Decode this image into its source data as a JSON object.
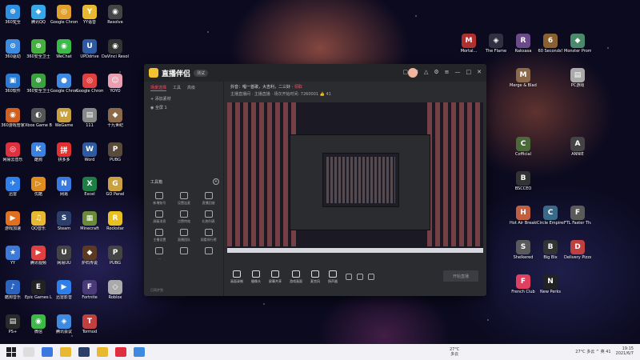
{
  "desktop": {
    "left_cols": [
      [
        {
          "label": "360安全",
          "color": "#2f8fe0",
          "ch": "⊕"
        },
        {
          "label": "360驱动",
          "color": "#3c8be0",
          "ch": "⊙"
        },
        {
          "label": "360软件",
          "color": "#2b7ad0",
          "ch": "▣"
        },
        {
          "label": "360游戏管家",
          "color": "#d06020",
          "ch": "◉"
        },
        {
          "label": "网易云音乐",
          "color": "#e03040",
          "ch": "◎"
        },
        {
          "label": "迅雷",
          "color": "#2f7fe8",
          "ch": "✈"
        },
        {
          "label": "游戏加速",
          "color": "#e07020",
          "ch": "▶"
        },
        {
          "label": "YY",
          "color": "#3d7ad8",
          "ch": "★"
        },
        {
          "label": "酷狗音乐",
          "color": "#2a63c0",
          "ch": "♪"
        },
        {
          "label": "PS+",
          "color": "#2a2a2a",
          "ch": "▤"
        }
      ],
      [
        {
          "label": "腾讯QQ",
          "color": "#37a7e8",
          "ch": "◆"
        },
        {
          "label": "360安全卫士",
          "color": "#45b040",
          "ch": "⊕"
        },
        {
          "label": "360安全卫士",
          "color": "#3aa040",
          "ch": "⊕"
        },
        {
          "label": "Xbox Game Bar",
          "color": "#555",
          "ch": "◐"
        },
        {
          "label": "酷狗",
          "color": "#3b82e0",
          "ch": "K"
        },
        {
          "label": "优酷",
          "color": "#e08d20",
          "ch": "▷"
        },
        {
          "label": "QQ音乐",
          "color": "#e8b830",
          "ch": "♫"
        },
        {
          "label": "腾讯视频",
          "color": "#e04040",
          "ch": "▶"
        },
        {
          "label": "Epic Games Launcher",
          "color": "#222",
          "ch": "E"
        },
        {
          "label": "微信",
          "color": "#3cba48",
          "ch": "◉"
        }
      ],
      [
        {
          "label": "Google Chrome",
          "color": "#e0a030",
          "ch": "◎"
        },
        {
          "label": "WeChat",
          "color": "#3cba48",
          "ch": "◉"
        },
        {
          "label": "Google Chrome",
          "color": "#3d8ae0",
          "ch": "●"
        },
        {
          "label": "WeGame",
          "color": "#c8a040",
          "ch": "W"
        },
        {
          "label": "拼多多",
          "color": "#e03030",
          "ch": "拼"
        },
        {
          "label": "网易",
          "color": "#3a7ae0",
          "ch": "N"
        },
        {
          "label": "Steam",
          "color": "#2a3f6a",
          "ch": "S"
        },
        {
          "label": "网易UU",
          "color": "#444",
          "ch": "U"
        },
        {
          "label": "迅雷影音",
          "color": "#2f7fe8",
          "ch": "▶"
        },
        {
          "label": "腾讯会议",
          "color": "#3d8ae0",
          "ch": "◈"
        }
      ],
      [
        {
          "label": "YY语音",
          "color": "#e8b830",
          "ch": "Y"
        },
        {
          "label": "UPDdrive",
          "color": "#2d5aa0",
          "ch": "U"
        },
        {
          "label": "Google Chrome",
          "color": "#e04040",
          "ch": "◎"
        },
        {
          "label": "111",
          "color": "#888",
          "ch": "▤"
        },
        {
          "label": "Word",
          "color": "#2d5aa0",
          "ch": "W"
        },
        {
          "label": "Excel",
          "color": "#1e7d45",
          "ch": "X"
        },
        {
          "label": "Minecraft",
          "color": "#6a8a3a",
          "ch": "▦"
        },
        {
          "label": "炉石传说",
          "color": "#5a3a20",
          "ch": "◆"
        },
        {
          "label": "Fortnite",
          "color": "#4a3a7a",
          "ch": "F"
        },
        {
          "label": "Tormod",
          "color": "#c04040",
          "ch": "T"
        }
      ],
      [
        {
          "label": "Resolve",
          "color": "#444",
          "ch": "◉"
        },
        {
          "label": "DaVinci Resolve",
          "color": "#333",
          "ch": "◉"
        },
        {
          "label": "YOYO",
          "color": "#e8a0b0",
          "ch": "☺"
        },
        {
          "label": "十九世纪",
          "color": "#8a6a4a",
          "ch": "◆"
        },
        {
          "label": "PUBG",
          "color": "#5a4a3a",
          "ch": "P"
        },
        {
          "label": "GO Panel",
          "color": "#caa040",
          "ch": "G"
        },
        {
          "label": "Rockstar",
          "color": "#e8c020",
          "ch": "R"
        },
        {
          "label": "PUBG",
          "color": "#444",
          "ch": "P"
        },
        {
          "label": "Roblox",
          "color": "#aaa",
          "ch": "◇"
        },
        {
          "label": "",
          "color": "transparent",
          "ch": ""
        }
      ]
    ],
    "right_cols": [
      [
        {
          "label": "Mortal...",
          "color": "#b03030",
          "ch": "M"
        },
        {
          "label": "",
          "color": "transparent",
          "ch": ""
        },
        {
          "label": "",
          "color": "transparent",
          "ch": ""
        },
        {
          "label": "",
          "color": "transparent",
          "ch": ""
        },
        {
          "label": "",
          "color": "transparent",
          "ch": ""
        },
        {
          "label": "",
          "color": "transparent",
          "ch": ""
        },
        {
          "label": "",
          "color": "transparent",
          "ch": ""
        },
        {
          "label": "",
          "color": "transparent",
          "ch": ""
        },
        {
          "label": "",
          "color": "transparent",
          "ch": ""
        }
      ],
      [
        {
          "label": "The Flame",
          "color": "#303040",
          "ch": "◈"
        },
        {
          "label": "",
          "color": "transparent",
          "ch": ""
        },
        {
          "label": "",
          "color": "transparent",
          "ch": ""
        },
        {
          "label": "",
          "color": "transparent",
          "ch": ""
        },
        {
          "label": "",
          "color": "transparent",
          "ch": ""
        },
        {
          "label": "",
          "color": "transparent",
          "ch": ""
        },
        {
          "label": "",
          "color": "transparent",
          "ch": ""
        },
        {
          "label": "",
          "color": "transparent",
          "ch": ""
        },
        {
          "label": "",
          "color": "transparent",
          "ch": ""
        }
      ],
      [
        {
          "label": "Raksasa",
          "color": "#6a4a8a",
          "ch": "R"
        },
        {
          "label": "Merge & Blade",
          "color": "#8a6a4a",
          "ch": "M"
        },
        {
          "label": "",
          "color": "transparent",
          "ch": ""
        },
        {
          "label": "Cofficial",
          "color": "#4a6a3a",
          "ch": "C"
        },
        {
          "label": "BSCCEO",
          "color": "#333",
          "ch": "B"
        },
        {
          "label": "Hot Air Breakfast",
          "color": "#c06040",
          "ch": "H"
        },
        {
          "label": "Shelkered",
          "color": "#5a5a5a",
          "ch": "S"
        },
        {
          "label": "French Club",
          "color": "#e04060",
          "ch": "F"
        },
        {
          "label": "",
          "color": "transparent",
          "ch": ""
        }
      ],
      [
        {
          "label": "60 Seconds!",
          "color": "#8a6030",
          "ch": "6"
        },
        {
          "label": "",
          "color": "transparent",
          "ch": ""
        },
        {
          "label": "",
          "color": "transparent",
          "ch": ""
        },
        {
          "label": "",
          "color": "transparent",
          "ch": ""
        },
        {
          "label": "",
          "color": "transparent",
          "ch": ""
        },
        {
          "label": "Circle Empires",
          "color": "#3a6a8a",
          "ch": "C"
        },
        {
          "label": "Big Bix",
          "color": "#333",
          "ch": "B"
        },
        {
          "label": "New Perks",
          "color": "#222",
          "ch": "N"
        },
        {
          "label": "",
          "color": "transparent",
          "ch": ""
        }
      ],
      [
        {
          "label": "Monster Prom",
          "color": "#4a8a6a",
          "ch": "◆"
        },
        {
          "label": "PC游戏",
          "color": "#aaa",
          "ch": "▤"
        },
        {
          "label": "",
          "color": "transparent",
          "ch": ""
        },
        {
          "label": "ANNIE",
          "color": "#444",
          "ch": "A"
        },
        {
          "label": "",
          "color": "transparent",
          "ch": ""
        },
        {
          "label": "FTL Faster Than Light",
          "color": "#5a5a5a",
          "ch": "F"
        },
        {
          "label": "Delivery Pizza",
          "color": "#c04040",
          "ch": "D"
        },
        {
          "label": "",
          "color": "transparent",
          "ch": ""
        },
        {
          "label": "",
          "color": "transparent",
          "ch": ""
        }
      ]
    ]
  },
  "app": {
    "name": "直播伴侣",
    "version": "测试",
    "tabs": [
      "场景选择",
      "工具",
      "高级"
    ],
    "active_tab": "场景选择",
    "scene_items": [
      "+ 添加素材",
      "◉  全屏 1"
    ],
    "info_line1": "抖音：唱一首歌，大吉利，二三好 · ",
    "info_red": "领取",
    "info_line2": "主播直播间 · 主播直播  ·  场次开始时间: 7260001   👍 41",
    "tools_title": "工具箱",
    "tools": [
      {
        "label": "新增账号"
      },
      {
        "label": "设置连麦"
      },
      {
        "label": "直播回放"
      },
      {
        "label": "屏蔽消息"
      },
      {
        "label": "点赞特效"
      },
      {
        "label": "礼物列表"
      },
      {
        "label": "主播设置"
      },
      {
        "label": "直播团队"
      },
      {
        "label": "观看排行榜"
      },
      {
        "label": "...",
        "row4": true
      },
      {
        "label": "",
        "row4": true
      },
      {
        "label": "",
        "row4": true
      }
    ],
    "left_footer": "已同步到 "
  },
  "controls": [
    {
      "label": "画面录制"
    },
    {
      "label": "摄像头"
    },
    {
      "label": "屏幕共享"
    },
    {
      "label": "游戏画面"
    },
    {
      "label": "麦克风"
    },
    {
      "label": "扬声器"
    }
  ],
  "controls_live": "开始直播",
  "taskbar": {
    "weather_temp": "27°C",
    "weather_desc": "多云",
    "tray_text": "27°C 多云 ^ 英 41",
    "time": "19:15",
    "date": "2021/6/7"
  },
  "colors": {
    "accent": "#ff4d66",
    "window_bg": "#2b2c30"
  }
}
